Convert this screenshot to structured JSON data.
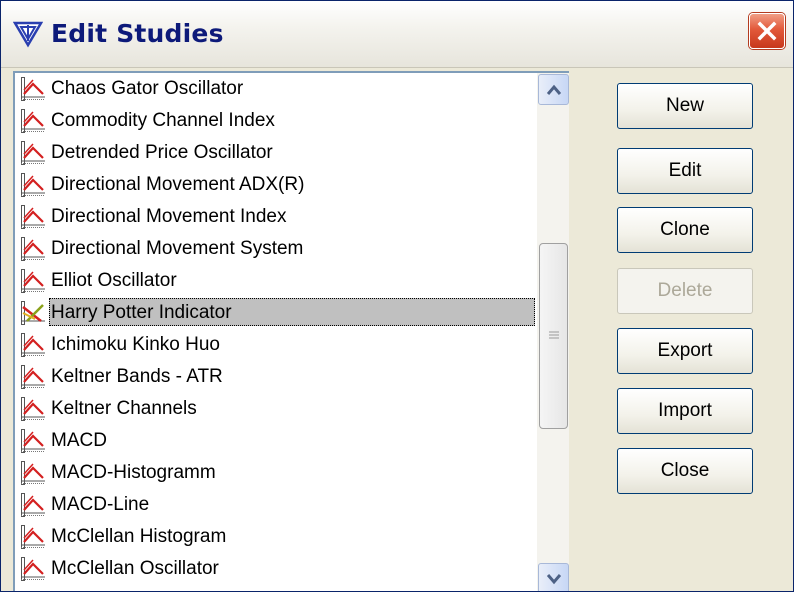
{
  "window": {
    "title": "Edit Studies"
  },
  "studies": [
    {
      "label": "Chaos Gator Oscillator",
      "icon": "chart-indicator-icon",
      "selected": false
    },
    {
      "label": "Commodity Channel Index",
      "icon": "chart-indicator-icon",
      "selected": false
    },
    {
      "label": "Detrended Price Oscillator",
      "icon": "chart-indicator-icon",
      "selected": false
    },
    {
      "label": "Directional Movement ADX(R)",
      "icon": "chart-indicator-icon",
      "selected": false
    },
    {
      "label": "Directional Movement Index",
      "icon": "chart-indicator-icon",
      "selected": false
    },
    {
      "label": "Directional Movement System",
      "icon": "chart-indicator-icon",
      "selected": false
    },
    {
      "label": "Elliot Oscillator",
      "icon": "chart-indicator-icon",
      "selected": false
    },
    {
      "label": "Harry Potter Indicator",
      "icon": "custom-indicator-icon",
      "selected": true
    },
    {
      "label": "Ichimoku Kinko Huo",
      "icon": "chart-indicator-icon",
      "selected": false
    },
    {
      "label": "Keltner Bands - ATR",
      "icon": "chart-indicator-icon",
      "selected": false
    },
    {
      "label": "Keltner Channels",
      "icon": "chart-indicator-icon",
      "selected": false
    },
    {
      "label": "MACD",
      "icon": "chart-indicator-icon",
      "selected": false
    },
    {
      "label": "MACD-Histogramm",
      "icon": "chart-indicator-icon",
      "selected": false
    },
    {
      "label": "MACD-Line",
      "icon": "chart-indicator-icon",
      "selected": false
    },
    {
      "label": "McClellan  Histogram",
      "icon": "chart-indicator-icon",
      "selected": false
    },
    {
      "label": "McClellan Oscillator",
      "icon": "chart-indicator-icon",
      "selected": false
    }
  ],
  "buttons": {
    "new": "New",
    "edit": "Edit",
    "clone": "Clone",
    "delete": "Delete",
    "export": "Export",
    "import": "Import",
    "close": "Close"
  },
  "colors": {
    "title_text": "#0d1a7a",
    "selection_bg": "#c0c0c0",
    "icon_red": "#d42020",
    "close_button": "#e2593a"
  }
}
